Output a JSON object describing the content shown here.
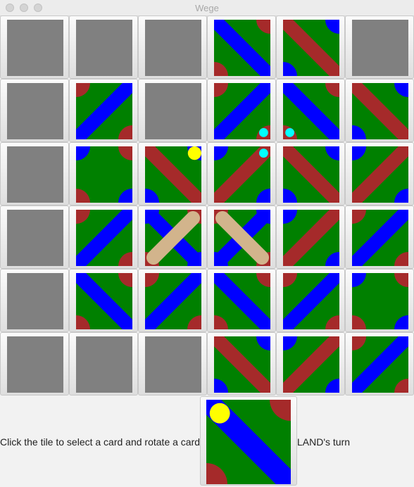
{
  "window": {
    "title": "Wege"
  },
  "colors": {
    "land": "#008000",
    "water": "#0000ff",
    "road": "#a52a2a",
    "bridge": "#d2b48c",
    "empty": "#808080",
    "gnome": "#ffff00",
    "token": "#00ffff"
  },
  "board": {
    "rows": [
      [
        {
          "empty": true
        },
        {
          "empty": true
        },
        {
          "empty": true
        },
        {
          "diag": "main",
          "diag_color": "water",
          "corners": [
            "road",
            "road"
          ]
        },
        {
          "diag": "main",
          "diag_color": "road",
          "corners": [
            "water",
            "water"
          ]
        },
        {
          "empty": true
        }
      ],
      [
        {
          "empty": true
        },
        {
          "diag": "anti",
          "diag_color": "water",
          "corners": [
            "road",
            "road"
          ]
        },
        {
          "empty": true
        },
        {
          "diag": "anti",
          "diag_color": "water",
          "corners": [
            "road",
            "road"
          ],
          "tokens": [
            {
              "color": "token",
              "pos": "br"
            }
          ]
        },
        {
          "diag": "main",
          "diag_color": "water",
          "corners": [
            "road",
            "road"
          ],
          "tokens": [
            {
              "color": "token",
              "pos": "bl"
            }
          ]
        },
        {
          "diag": "main",
          "diag_color": "road",
          "corners": [
            "water",
            "water"
          ]
        }
      ],
      [
        {
          "empty": true
        },
        {
          "diag": "none",
          "corners4": [
            "water",
            "road",
            "road",
            "water"
          ]
        },
        {
          "diag": "main",
          "diag_color": "road",
          "corners": [
            "water",
            "water"
          ],
          "tokens": [
            {
              "color": "gnome",
              "pos": "tr"
            }
          ]
        },
        {
          "diag": "anti",
          "diag_color": "road",
          "corners": [
            "water",
            "water"
          ],
          "tokens": [
            {
              "color": "token",
              "pos": "tr"
            }
          ]
        },
        {
          "diag": "main",
          "diag_color": "road",
          "corners": [
            "water",
            "water"
          ]
        },
        {
          "diag": "anti",
          "diag_color": "road",
          "corners": [
            "water",
            "water"
          ]
        }
      ],
      [
        {
          "empty": true
        },
        {
          "diag": "anti",
          "diag_color": "water",
          "corners": [
            "road",
            "road"
          ]
        },
        {
          "diag": "cross",
          "diag_color": "water",
          "cross_color": "bridge",
          "corners4": [
            "water",
            "road",
            "road",
            "water"
          ]
        },
        {
          "diag": "cross2",
          "diag_color": "water",
          "cross_color": "bridge",
          "corners4": [
            "road",
            "water",
            "water",
            "road"
          ]
        },
        {
          "diag": "anti",
          "diag_color": "road",
          "corners": [
            "water",
            "water"
          ]
        },
        {
          "diag": "anti",
          "diag_color": "water",
          "corners": [
            "road",
            "road"
          ]
        }
      ],
      [
        {
          "empty": true
        },
        {
          "diag": "main",
          "diag_color": "water",
          "corners": [
            "road",
            "road"
          ]
        },
        {
          "diag": "anti",
          "diag_color": "water",
          "corners": [
            "road",
            "road"
          ]
        },
        {
          "diag": "main",
          "diag_color": "water",
          "corners": [
            "road",
            "road"
          ]
        },
        {
          "diag": "anti",
          "diag_color": "water",
          "corners": [
            "road",
            "road"
          ]
        },
        {
          "diag": "none",
          "corners4": [
            "water",
            "road",
            "road",
            "water"
          ]
        }
      ],
      [
        {
          "empty": true
        },
        {
          "empty": true
        },
        {
          "empty": true
        },
        {
          "diag": "main",
          "diag_color": "road",
          "corners": [
            "water",
            "water"
          ]
        },
        {
          "diag": "anti",
          "diag_color": "road",
          "corners": [
            "water",
            "water"
          ]
        },
        {
          "diag": "anti",
          "diag_color": "water",
          "corners": [
            "road",
            "road"
          ]
        }
      ]
    ]
  },
  "status": {
    "instruction": "Click the tile to select a card and rotate a card",
    "turn": "LAND's turn"
  },
  "current_card": {
    "diag": "main",
    "diag_color": "water",
    "corners": [
      "road",
      "road"
    ],
    "tokens": [
      {
        "color": "gnome",
        "pos": "tl"
      }
    ]
  }
}
